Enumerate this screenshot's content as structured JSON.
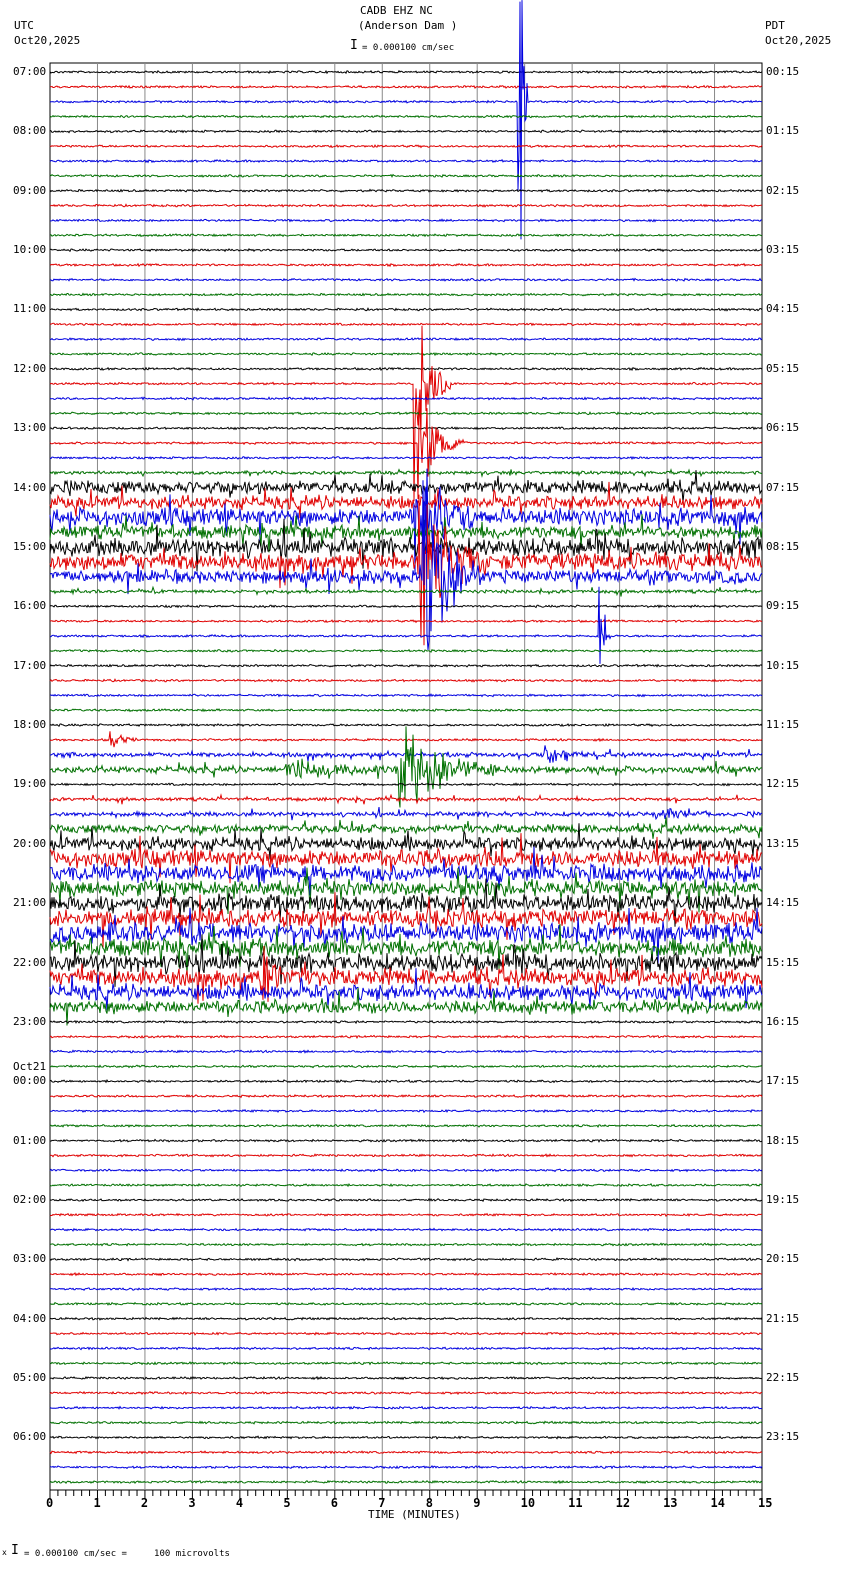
{
  "header": {
    "station": "CADB EHZ NC",
    "location": "(Anderson Dam )",
    "scale": "= 0.000100 cm/sec",
    "left_tz": "UTC",
    "left_date": "Oct20,2025",
    "right_tz": "PDT",
    "right_date": "Oct20,2025"
  },
  "footer": {
    "scale_note": "= 0.000100 cm/sec =     100 microvolts",
    "mark": "x"
  },
  "chart_data": {
    "type": "line",
    "title": "CADB EHZ NC (Anderson Dam )",
    "xlabel": "TIME (MINUTES)",
    "xlim": [
      0,
      15
    ],
    "x_ticks": [
      "0",
      "1",
      "2",
      "3",
      "4",
      "5",
      "6",
      "7",
      "8",
      "9",
      "10",
      "11",
      "12",
      "13",
      "14",
      "15"
    ],
    "trace_colors": [
      "#000000",
      "#e00000",
      "#0000e0",
      "#007000"
    ],
    "traces_per_hour": 4,
    "utc_labels": [
      "07:00",
      "08:00",
      "09:00",
      "10:00",
      "11:00",
      "12:00",
      "13:00",
      "14:00",
      "15:00",
      "16:00",
      "17:00",
      "18:00",
      "19:00",
      "20:00",
      "21:00",
      "22:00",
      "23:00",
      "00:00",
      "01:00",
      "02:00",
      "03:00",
      "04:00",
      "05:00",
      "06:00"
    ],
    "date_change": {
      "hour_index": 17,
      "label": "Oct21"
    },
    "pdt_labels": [
      "00:15",
      "01:15",
      "02:15",
      "03:15",
      "04:15",
      "05:15",
      "06:15",
      "07:15",
      "08:15",
      "09:15",
      "10:15",
      "11:15",
      "12:15",
      "13:15",
      "14:15",
      "15:15",
      "16:15",
      "17:15",
      "18:15",
      "19:15",
      "20:15",
      "21:15",
      "22:15",
      "23:15"
    ],
    "noise_levels": [
      1,
      1,
      1,
      1,
      1,
      1,
      1,
      1,
      1,
      1,
      1,
      1,
      1,
      1,
      1,
      1,
      1,
      1,
      1,
      1,
      1,
      1,
      1,
      1,
      1,
      1,
      1,
      1.5,
      6,
      6,
      8,
      6,
      8,
      8,
      6,
      1.5,
      1,
      1,
      1,
      1,
      1,
      1,
      1,
      1,
      1,
      1,
      2,
      3,
      1,
      1.5,
      2,
      4,
      6,
      8,
      8,
      7,
      8,
      8,
      9,
      8,
      8,
      8,
      7,
      6,
      1,
      1,
      1,
      1,
      1,
      1,
      1,
      1,
      1,
      1,
      1,
      1,
      1,
      1,
      1,
      1,
      1,
      1,
      1,
      1,
      1,
      1,
      1,
      1,
      1,
      1,
      1,
      1,
      1,
      1,
      1,
      1
    ],
    "events": [
      {
        "trace": 2,
        "minute": 9.9,
        "amplitude": 520,
        "duration": 0.15
      },
      {
        "trace": 21,
        "minute": 7.7,
        "amplitude": 120,
        "duration": 0.8
      },
      {
        "trace": 25,
        "minute": 7.8,
        "amplitude": 60,
        "duration": 1.0
      },
      {
        "trace": 30,
        "minute": 7.7,
        "amplitude": 50,
        "duration": 1.5
      },
      {
        "trace": 33,
        "minute": 7.8,
        "amplitude": 80,
        "duration": 1.4
      },
      {
        "trace": 34,
        "minute": 7.9,
        "amplitude": 90,
        "duration": 1.2
      },
      {
        "trace": 38,
        "minute": 11.6,
        "amplitude": 80,
        "duration": 0.2
      },
      {
        "trace": 45,
        "minute": 1.3,
        "amplitude": 8,
        "duration": 0.6
      },
      {
        "trace": 46,
        "minute": 10.4,
        "amplitude": 18,
        "duration": 0.8
      },
      {
        "trace": 47,
        "minute": 7.4,
        "amplitude": 45,
        "duration": 2.0
      },
      {
        "trace": 47,
        "minute": 5.0,
        "amplitude": 10,
        "duration": 3.0
      },
      {
        "trace": 50,
        "minute": 12.8,
        "amplitude": 6,
        "duration": 1.5
      },
      {
        "trace": 61,
        "minute": 4.5,
        "amplitude": 25,
        "duration": 0.6
      }
    ]
  }
}
